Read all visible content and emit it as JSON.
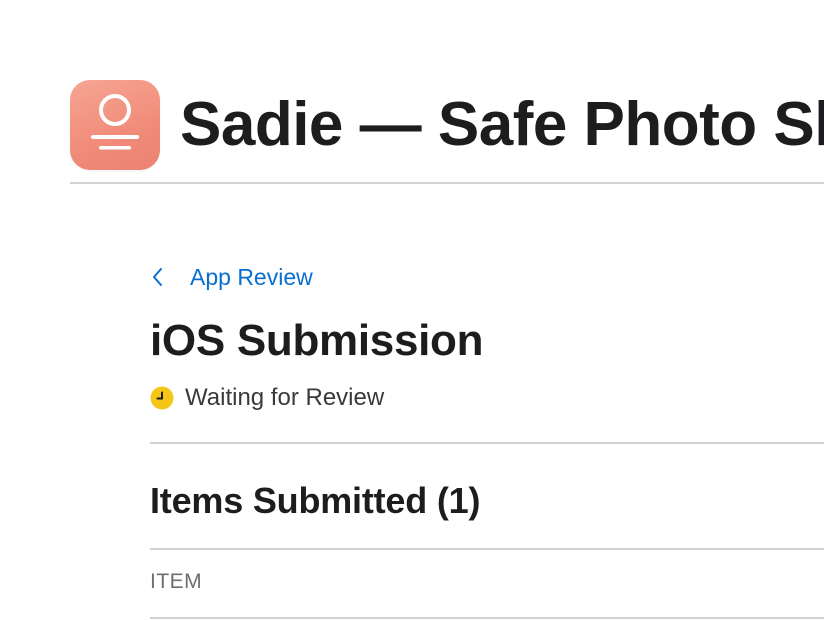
{
  "app": {
    "title": "Sadie — Safe Photo Sharing",
    "icon": "person-profile-icon",
    "icon_color": "#f08c79"
  },
  "breadcrumb": {
    "label": "App Review",
    "icon": "chevron-left-icon",
    "color": "#0a6fce"
  },
  "page": {
    "title": "iOS Submission"
  },
  "status": {
    "label": "Waiting for Review",
    "icon": "clock-icon",
    "color": "#f5c518"
  },
  "items_section": {
    "title": "Items Submitted (1)",
    "columns": [
      "ITEM"
    ]
  }
}
